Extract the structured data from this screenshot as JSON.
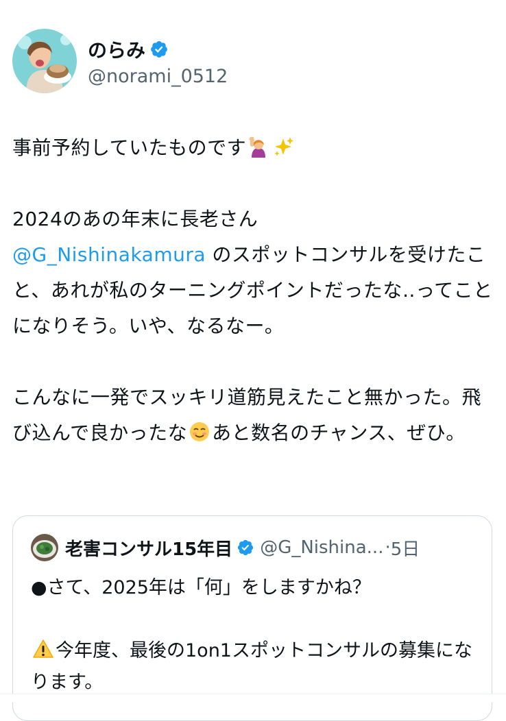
{
  "author": {
    "display_name": "のらみ",
    "handle": "@norami_0512",
    "verified": true,
    "avatar_icon": "profile-photo-avatar"
  },
  "tweet": {
    "line1": "事前予約していたものです",
    "line1_emojis": [
      "person-raising-hand-emoji",
      "sparkles-emoji"
    ],
    "para2_prefix": "2024のあの年末に長老さん\n",
    "mention": "@G_Nishinakamura",
    "para2_suffix": " のスポットコンサルを受けたこと、あれが私のターニングポイントだったな‥ってことになりそう。いや、なるなー。",
    "para3_prefix": "こんなに一発でスッキリ道筋見えたこと無かった。飛び込んで良かったな",
    "para3_emoji": "smiling-face-emoji",
    "para3_suffix": "あと数名のチャンス、ぜひ。"
  },
  "quote": {
    "display_name": "老害コンサル15年目",
    "handle": "@G_Nishina...",
    "separator": "·",
    "time": "5日",
    "verified": true,
    "line1": "●さて、2025年は「何」をしますかね？",
    "line2_emoji": "warning-emoji",
    "line2": "今年度、最後の1on1スポットコンサルの募集になります。"
  },
  "colors": {
    "text": "#0f1419",
    "secondary": "#536471",
    "link": "#1d9bf0",
    "verified": "#1d9bf0",
    "border": "#cfd9de"
  }
}
